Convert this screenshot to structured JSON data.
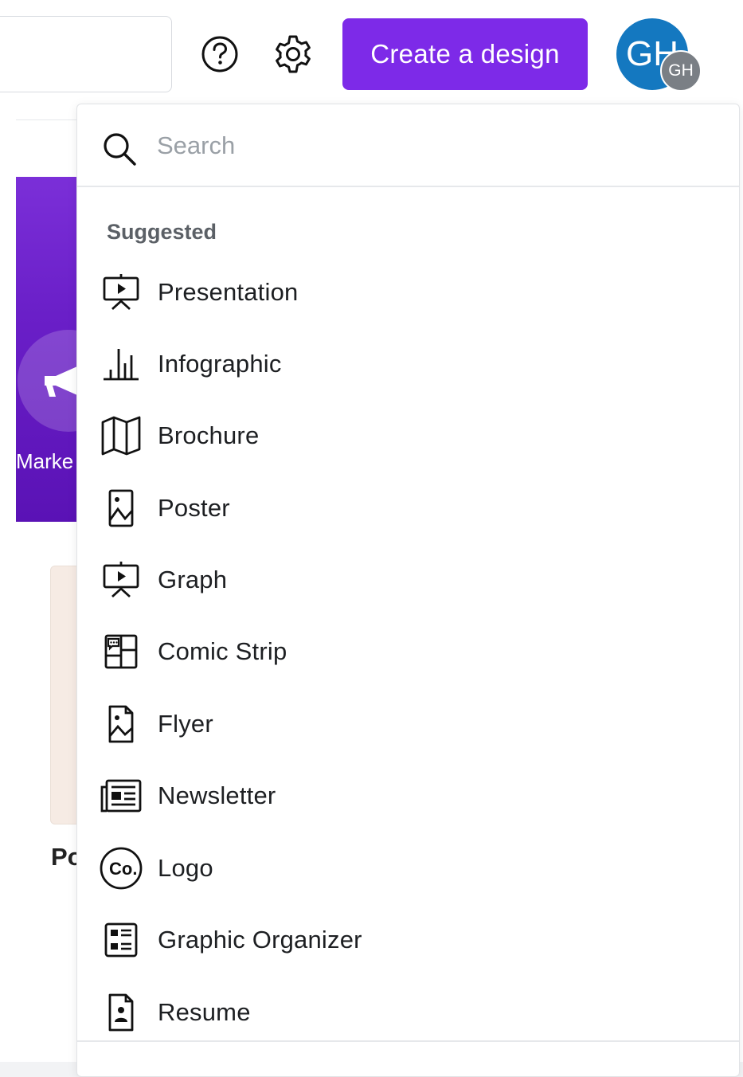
{
  "header": {
    "help_icon": "question-circle-icon",
    "settings_icon": "gear-icon",
    "create_button_label": "Create a design",
    "avatar_initials": "GH",
    "avatar_badge_initials": "GH",
    "accent_color": "#7d2ae8",
    "avatar_color": "#1478c0"
  },
  "background": {
    "banner_label": "Marke",
    "card_label": "Po"
  },
  "dropdown": {
    "search_placeholder": "Search",
    "section_title": "Suggested",
    "items": [
      {
        "label": "Presentation",
        "icon": "presentation-icon"
      },
      {
        "label": "Infographic",
        "icon": "bar-chart-icon"
      },
      {
        "label": "Brochure",
        "icon": "folded-map-icon"
      },
      {
        "label": "Poster",
        "icon": "poster-image-icon"
      },
      {
        "label": "Graph",
        "icon": "presentation-icon"
      },
      {
        "label": "Comic Strip",
        "icon": "comic-strip-icon"
      },
      {
        "label": "Flyer",
        "icon": "flyer-icon"
      },
      {
        "label": "Newsletter",
        "icon": "newspaper-icon"
      },
      {
        "label": "Logo",
        "icon": "logo-co-icon"
      },
      {
        "label": "Graphic Organizer",
        "icon": "organizer-list-icon"
      },
      {
        "label": "Resume",
        "icon": "resume-icon"
      }
    ]
  }
}
